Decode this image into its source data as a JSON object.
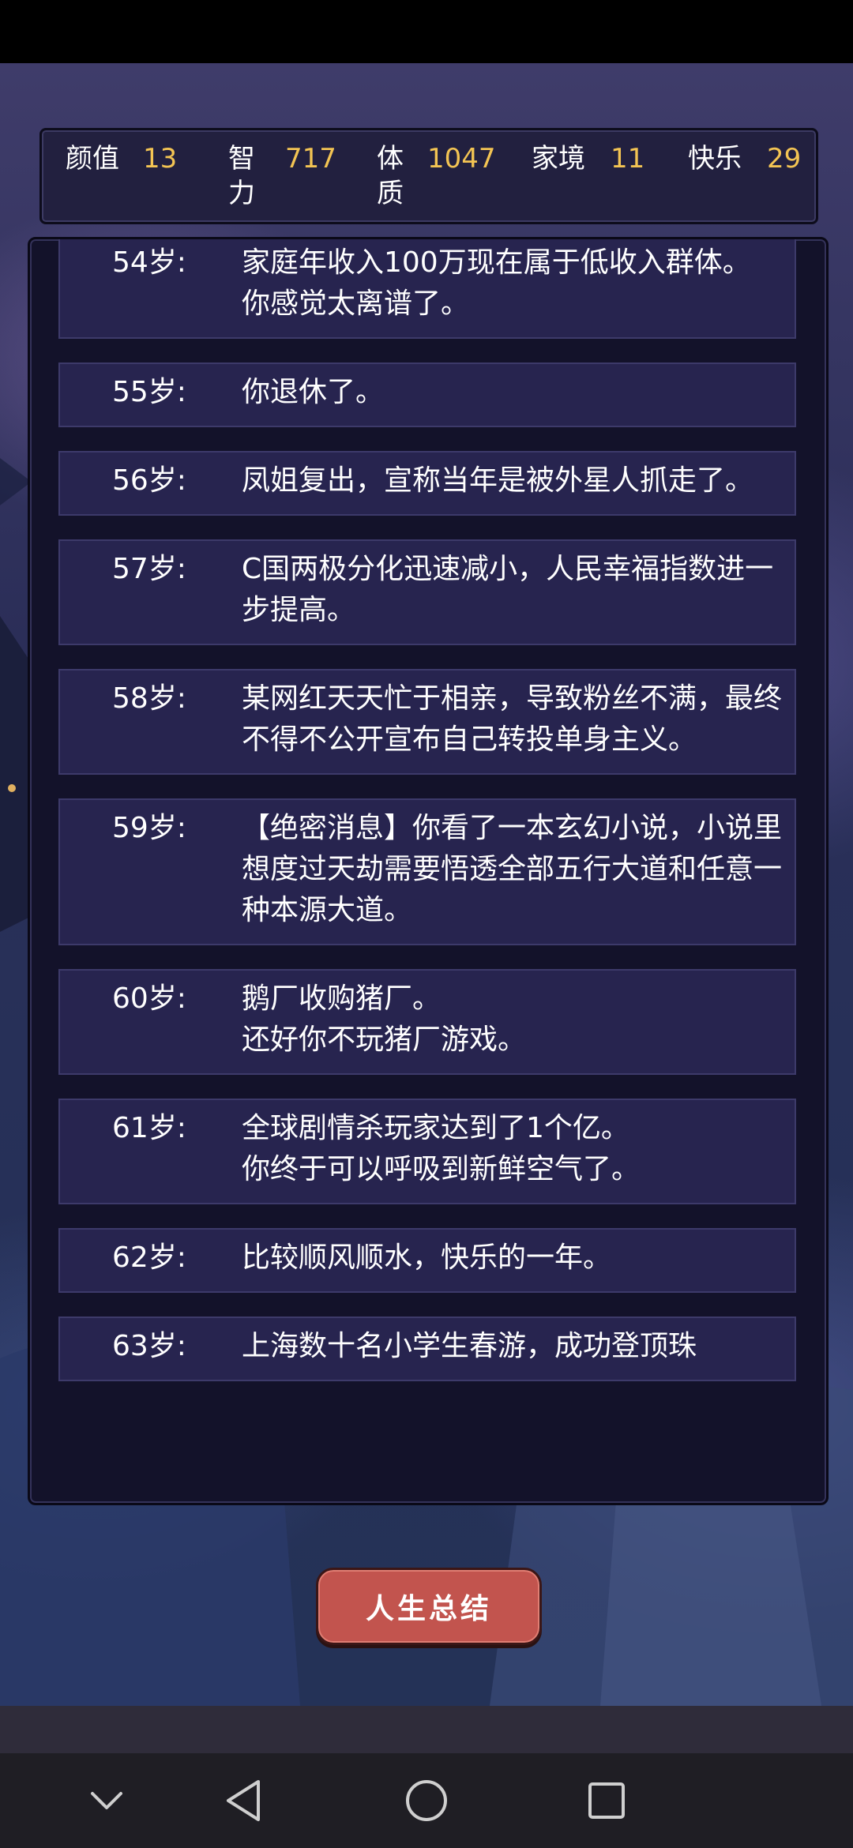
{
  "stats": [
    {
      "label": "颜值",
      "value": "13"
    },
    {
      "label": "智力",
      "value": "717"
    },
    {
      "label": "体质",
      "value": "1047"
    },
    {
      "label": "家境",
      "value": "11"
    },
    {
      "label": "快乐",
      "value": "29"
    }
  ],
  "entries": [
    {
      "age": "54岁:",
      "lines": [
        "家庭年收入100万现在属于低收入群体。",
        "你感觉太离谱了。"
      ]
    },
    {
      "age": "55岁:",
      "lines": [
        "你退休了。"
      ]
    },
    {
      "age": "56岁:",
      "lines": [
        "凤姐复出，宣称当年是被外星人抓走了。"
      ]
    },
    {
      "age": "57岁:",
      "lines": [
        "C国两极分化迅速减小，人民幸福指数进一步提高。"
      ]
    },
    {
      "age": "58岁:",
      "lines": [
        "某网红天天忙于相亲，导致粉丝不满，最终不得不公开宣布自己转投单身主义。"
      ]
    },
    {
      "age": "59岁:",
      "lines": [
        "【绝密消息】你看了一本玄幻小说，小说里想度过天劫需要悟透全部五行大道和任意一种本源大道。"
      ]
    },
    {
      "age": "60岁:",
      "lines": [
        "鹅厂收购猪厂。",
        "还好你不玩猪厂游戏。"
      ]
    },
    {
      "age": "61岁:",
      "lines": [
        "全球剧情杀玩家达到了1个亿。",
        "你终于可以呼吸到新鲜空气了。"
      ]
    },
    {
      "age": "62岁:",
      "lines": [
        "比较顺风顺水，快乐的一年。"
      ]
    },
    {
      "age": "63岁:",
      "lines": [
        "上海数十名小学生春游，成功登顶珠"
      ]
    }
  ],
  "summary_button": "人生总结",
  "nav": {
    "collapse_icon": "chevron-down-icon",
    "back_icon": "triangle-back-icon",
    "home_icon": "circle-home-icon",
    "recents_icon": "square-recents-icon"
  },
  "colors": {
    "stat_value": "#f3c453",
    "entry_bg": "#27244f",
    "button": "#c2544e"
  }
}
